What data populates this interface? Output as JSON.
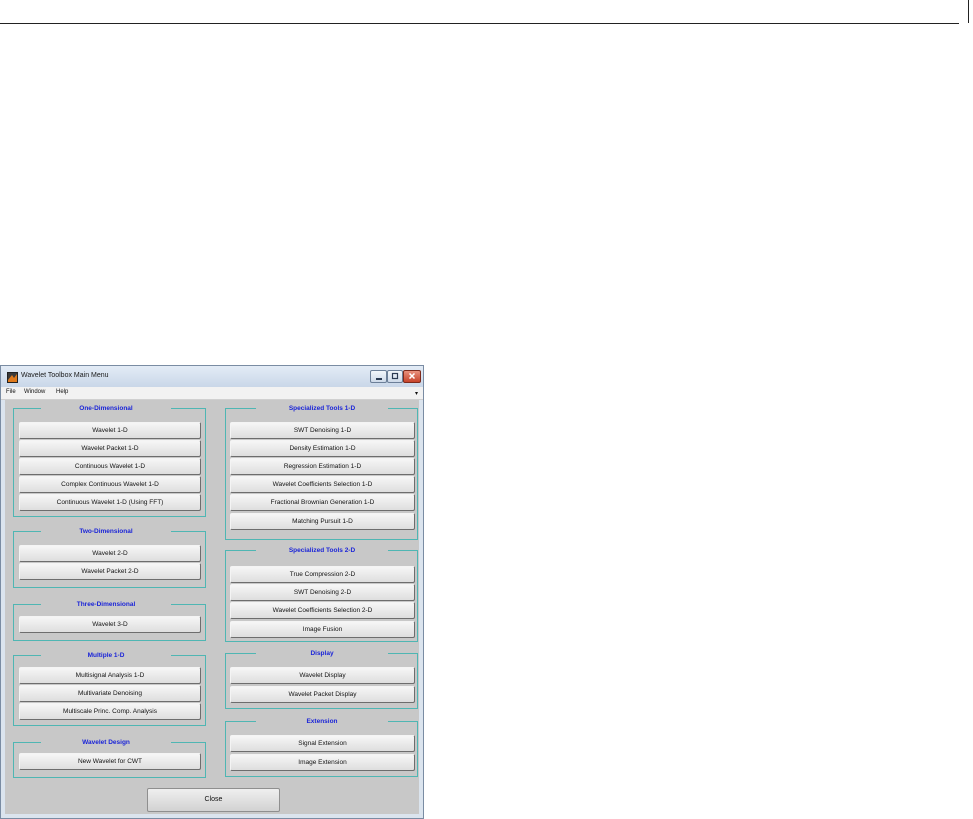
{
  "window": {
    "title": "Wavelet Toolbox Main Menu",
    "menus": [
      "File",
      "Window",
      "Help"
    ],
    "menu_overflow": "▾",
    "controls": {
      "minimize": "minimize-icon",
      "maximize": "maximize-icon",
      "close": "close-icon"
    }
  },
  "panels": {
    "one_d": {
      "title": "One-Dimensional",
      "buttons": [
        "Wavelet 1-D",
        "Wavelet Packet 1-D",
        "Continuous Wavelet 1-D",
        "Complex Continuous Wavelet 1-D",
        "Continuous Wavelet 1-D (Using FFT)"
      ]
    },
    "two_d": {
      "title": "Two-Dimensional",
      "buttons": [
        "Wavelet 2-D",
        "Wavelet Packet 2-D"
      ]
    },
    "three_d": {
      "title": "Three-Dimensional",
      "buttons": [
        "Wavelet 3-D"
      ]
    },
    "multiple_1d": {
      "title": "Multiple 1-D",
      "buttons": [
        "Multisignal Analysis 1-D",
        "Multivariate Denoising",
        "Multiscale Princ. Comp. Analysis"
      ]
    },
    "wavelet_design": {
      "title": "Wavelet Design",
      "buttons": [
        "New Wavelet for CWT"
      ]
    },
    "spec_1d": {
      "title": "Specialized Tools 1-D",
      "buttons": [
        "SWT Denoising 1-D",
        "Density Estimation 1-D",
        "Regression Estimation 1-D",
        "Wavelet Coefficients Selection 1-D",
        "Fractional Brownian Generation 1-D",
        "Matching Pursuit 1-D"
      ]
    },
    "spec_2d": {
      "title": "Specialized Tools 2-D",
      "buttons": [
        "True Compression 2-D",
        "SWT Denoising 2-D",
        "Wavelet Coefficients Selection 2-D",
        "Image Fusion"
      ]
    },
    "display": {
      "title": "Display",
      "buttons": [
        "Wavelet Display",
        "Wavelet Packet Display"
      ]
    },
    "extension": {
      "title": "Extension",
      "buttons": [
        "Signal Extension",
        "Image Extension"
      ]
    }
  },
  "close_label": "Close"
}
